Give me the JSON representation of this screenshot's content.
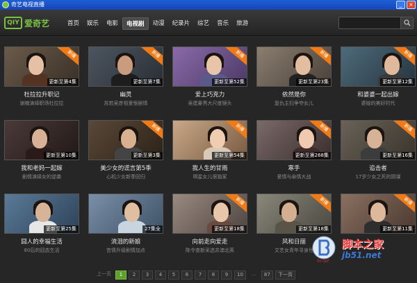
{
  "window": {
    "title": "奇艺电视直播"
  },
  "logo": {
    "mark": "QIY",
    "text": "爱奇艺"
  },
  "nav": [
    {
      "label": "首页",
      "active": false
    },
    {
      "label": "娱乐",
      "active": false
    },
    {
      "label": "电影",
      "active": false
    },
    {
      "label": "电视剧",
      "active": true
    },
    {
      "label": "动漫",
      "active": false
    },
    {
      "label": "纪录片",
      "active": false
    },
    {
      "label": "综艺",
      "active": false
    },
    {
      "label": "音乐",
      "active": false
    },
    {
      "label": "旅游",
      "active": false
    }
  ],
  "search": {
    "value": "",
    "placeholder": ""
  },
  "cards": [
    {
      "title": "杜拉拉升职记",
      "desc": "谢楠演绎职场杜拉拉",
      "episode": "更新至第4集",
      "ribbon": "新播",
      "colors": [
        "#6a5a4a",
        "#3a3028"
      ],
      "skin": "#e6c0a5",
      "shirt": "#553322"
    },
    {
      "title": "幽灵",
      "desc": "苏若吴彦祖爱恨剧情",
      "episode": "更新至第7集",
      "ribbon": "新播",
      "colors": [
        "#4c5560",
        "#2a2f35"
      ],
      "skin": "#c99c80",
      "shirt": "#1d1d1d"
    },
    {
      "title": "爱上巧克力",
      "desc": "吴建豪秀大尺度镜头",
      "episode": "更新至第52集",
      "ribbon": "新播",
      "colors": [
        "#8a6aa8",
        "#4b3a66"
      ],
      "skin": "#e8c4a8",
      "shirt": "#5a5a8a"
    },
    {
      "title": "依然是你",
      "desc": "复仇主妇争夺女儿",
      "episode": "更新至第23集",
      "ribbon": "新播",
      "colors": [
        "#8a7e70",
        "#4a4038"
      ],
      "skin": "#e2bda0",
      "shirt": "#222222"
    },
    {
      "title": "和婆婆一起出嫁",
      "desc": "婆媳的美好时代",
      "episode": "更新至第12集",
      "ribbon": "新播",
      "colors": [
        "#4e6a7a",
        "#263540"
      ],
      "skin": "#e0b99c",
      "shirt": "#3a3a3a"
    },
    {
      "title": "我和老妈一起嫁",
      "desc": "剧情演绎女的逆袭",
      "episode": "更新至第10集",
      "ribbon": "",
      "colors": [
        "#4a3a38",
        "#221818"
      ],
      "skin": "#d8b096",
      "shirt": "#2a1a1a"
    },
    {
      "title": "美少女的谎言第5季",
      "desc": "心机少女新季回归",
      "episode": "更新至第3集",
      "ribbon": "新播",
      "colors": [
        "#5a4838",
        "#2c2218"
      ],
      "skin": "#d9b090",
      "shirt": "#444444"
    },
    {
      "title": "我人生的甘雨",
      "desc": "明星女儿很独家",
      "episode": "更新至第54集",
      "ribbon": "新播",
      "colors": [
        "#c8a888",
        "#7a5a40"
      ],
      "skin": "#f0cdb0",
      "shirt": "#d8c8b8"
    },
    {
      "title": "寒手",
      "desc": "爱情与亲情大战",
      "episode": "更新至第268集",
      "ribbon": "新播",
      "colors": [
        "#7a6a68",
        "#3a2e2c"
      ],
      "skin": "#efcab0",
      "shirt": "#402a2a"
    },
    {
      "title": "追击者",
      "desc": "17岁少女之死的阴谋",
      "episode": "更新至第16集",
      "ribbon": "新播",
      "colors": [
        "#6a6258",
        "#3a342c"
      ],
      "skin": "#d8b294",
      "shirt": "#3c3c3c"
    },
    {
      "title": "囧人的幸福生活",
      "desc": "80后的囧态生活",
      "episode": "更新至第25集",
      "ribbon": "",
      "colors": [
        "#5a7a98",
        "#2e4258"
      ],
      "skin": "#d7b498",
      "shirt": "#e6e6e6"
    },
    {
      "title": "流泪的新娘",
      "desc": "苦情升级剧情加点",
      "episode": "27集全",
      "ribbon": "",
      "colors": [
        "#7a90a8",
        "#3e5266"
      ],
      "skin": "#e0bea2",
      "shirt": "#c8d4e0"
    },
    {
      "title": "向前走向爱走",
      "desc": "陈令查新采选苏澳北英",
      "episode": "更新至第18集",
      "ribbon": "新播",
      "colors": [
        "#9a8a80",
        "#4e4440"
      ],
      "skin": "#e8c6aa",
      "shirt": "#6a4a40"
    },
    {
      "title": "风和日丽",
      "desc": "文艺女青年寻身世",
      "episode": "更新至第18集",
      "ribbon": "新播",
      "colors": [
        "#8a887a",
        "#4a4840"
      ],
      "skin": "#d4ae90",
      "shirt": "#5a5448"
    },
    {
      "title": "",
      "desc": "",
      "episode": "更新至第11集",
      "ribbon": "新播",
      "colors": [
        "#8a7060",
        "#4a3830"
      ],
      "skin": "#deb89a",
      "shirt": "#2e2e2e"
    }
  ],
  "pagination": {
    "prev": "上一页",
    "pages": [
      "1",
      "2",
      "3",
      "4",
      "5",
      "6",
      "7",
      "8",
      "9",
      "10",
      "...",
      "87"
    ],
    "current": "1",
    "next": "下一页"
  },
  "watermark": {
    "text": "脚本之家",
    "url": "jb51.net",
    "script": "Script"
  }
}
